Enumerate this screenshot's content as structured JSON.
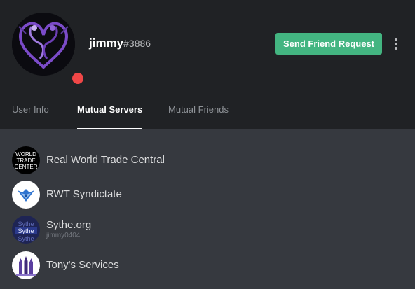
{
  "profile": {
    "username": "jimmy",
    "discriminator": "#3886",
    "status": "dnd",
    "status_color": "#f04747",
    "avatar_icon": "purple-dragon-heart-avatar"
  },
  "actions": {
    "friend_request_label": "Send Friend Request",
    "friend_request_color": "#43b581",
    "more_icon": "vertical-ellipsis-icon"
  },
  "tabs": [
    {
      "label": "User Info",
      "active": false
    },
    {
      "label": "Mutual Servers",
      "active": true
    },
    {
      "label": "Mutual Friends",
      "active": false
    }
  ],
  "servers": [
    {
      "name": "Real World Trade Central",
      "nickname": "",
      "icon": "world-trade-center-logo"
    },
    {
      "name": "RWT Syndictate",
      "nickname": "",
      "icon": "blue-winged-crest-logo"
    },
    {
      "name": "Sythe.org",
      "nickname": "jimmy0404",
      "icon": "sythe-logo"
    },
    {
      "name": "Tony's Services",
      "nickname": "",
      "icon": "purple-rockets-logo"
    }
  ],
  "colors": {
    "header_bg": "#202225",
    "body_bg": "#36393f"
  }
}
